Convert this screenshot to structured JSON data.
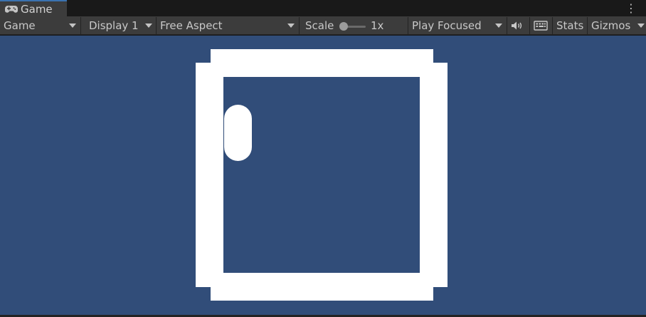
{
  "tab": {
    "label": "Game",
    "icon": "gamepad-icon"
  },
  "toolbar": {
    "view_mode": "Game",
    "display": "Display 1",
    "aspect": "Free Aspect",
    "scale_label": "Scale",
    "scale_value": "1x",
    "play_mode": "Play Focused",
    "audio_icon": "speaker-icon",
    "keyboard_icon": "keyboard-icon",
    "stats_label": "Stats",
    "gizmos_label": "Gizmos"
  },
  "colors": {
    "viewport_background": "#314d79",
    "toolbar_background": "#3c3c3c",
    "game_objects": "#ffffff"
  }
}
